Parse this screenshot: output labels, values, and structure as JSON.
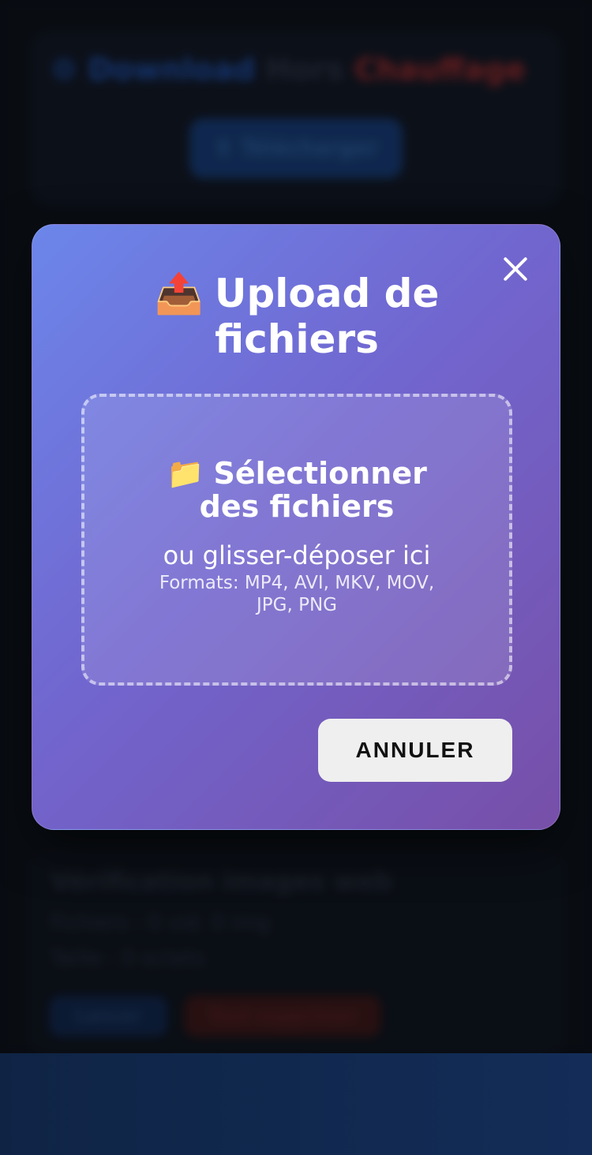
{
  "background": {
    "header": {
      "icon": "gear-icon",
      "part1": "Download",
      "part2": "Hors",
      "part3": "Chauffage"
    },
    "main_button": {
      "icon": "upload-icon",
      "label": "Télécharger"
    },
    "section": {
      "title": "Vérification images web",
      "row1": "Fichiers : 0 vid. 0 img",
      "row2": "Taille : 0 octets",
      "button1": "Lancer",
      "button2": "Tout supprimer"
    }
  },
  "modal": {
    "title_icon": "📤",
    "title": "Upload de fichiers",
    "close_icon": "close-icon",
    "drop_zone": {
      "icon": "📁",
      "select_label": "Sélectionner des fichiers",
      "hint": "ou glisser-déposer ici",
      "formats": "Formats: MP4, AVI, MKV, MOV, JPG, PNG"
    },
    "cancel_label": "ANNULER"
  },
  "colors": {
    "modal_gradient_start": "#6c86ea",
    "modal_gradient_end": "#774fa8",
    "cancel_bg": "#efefef",
    "bottom_band": "#132d58"
  }
}
